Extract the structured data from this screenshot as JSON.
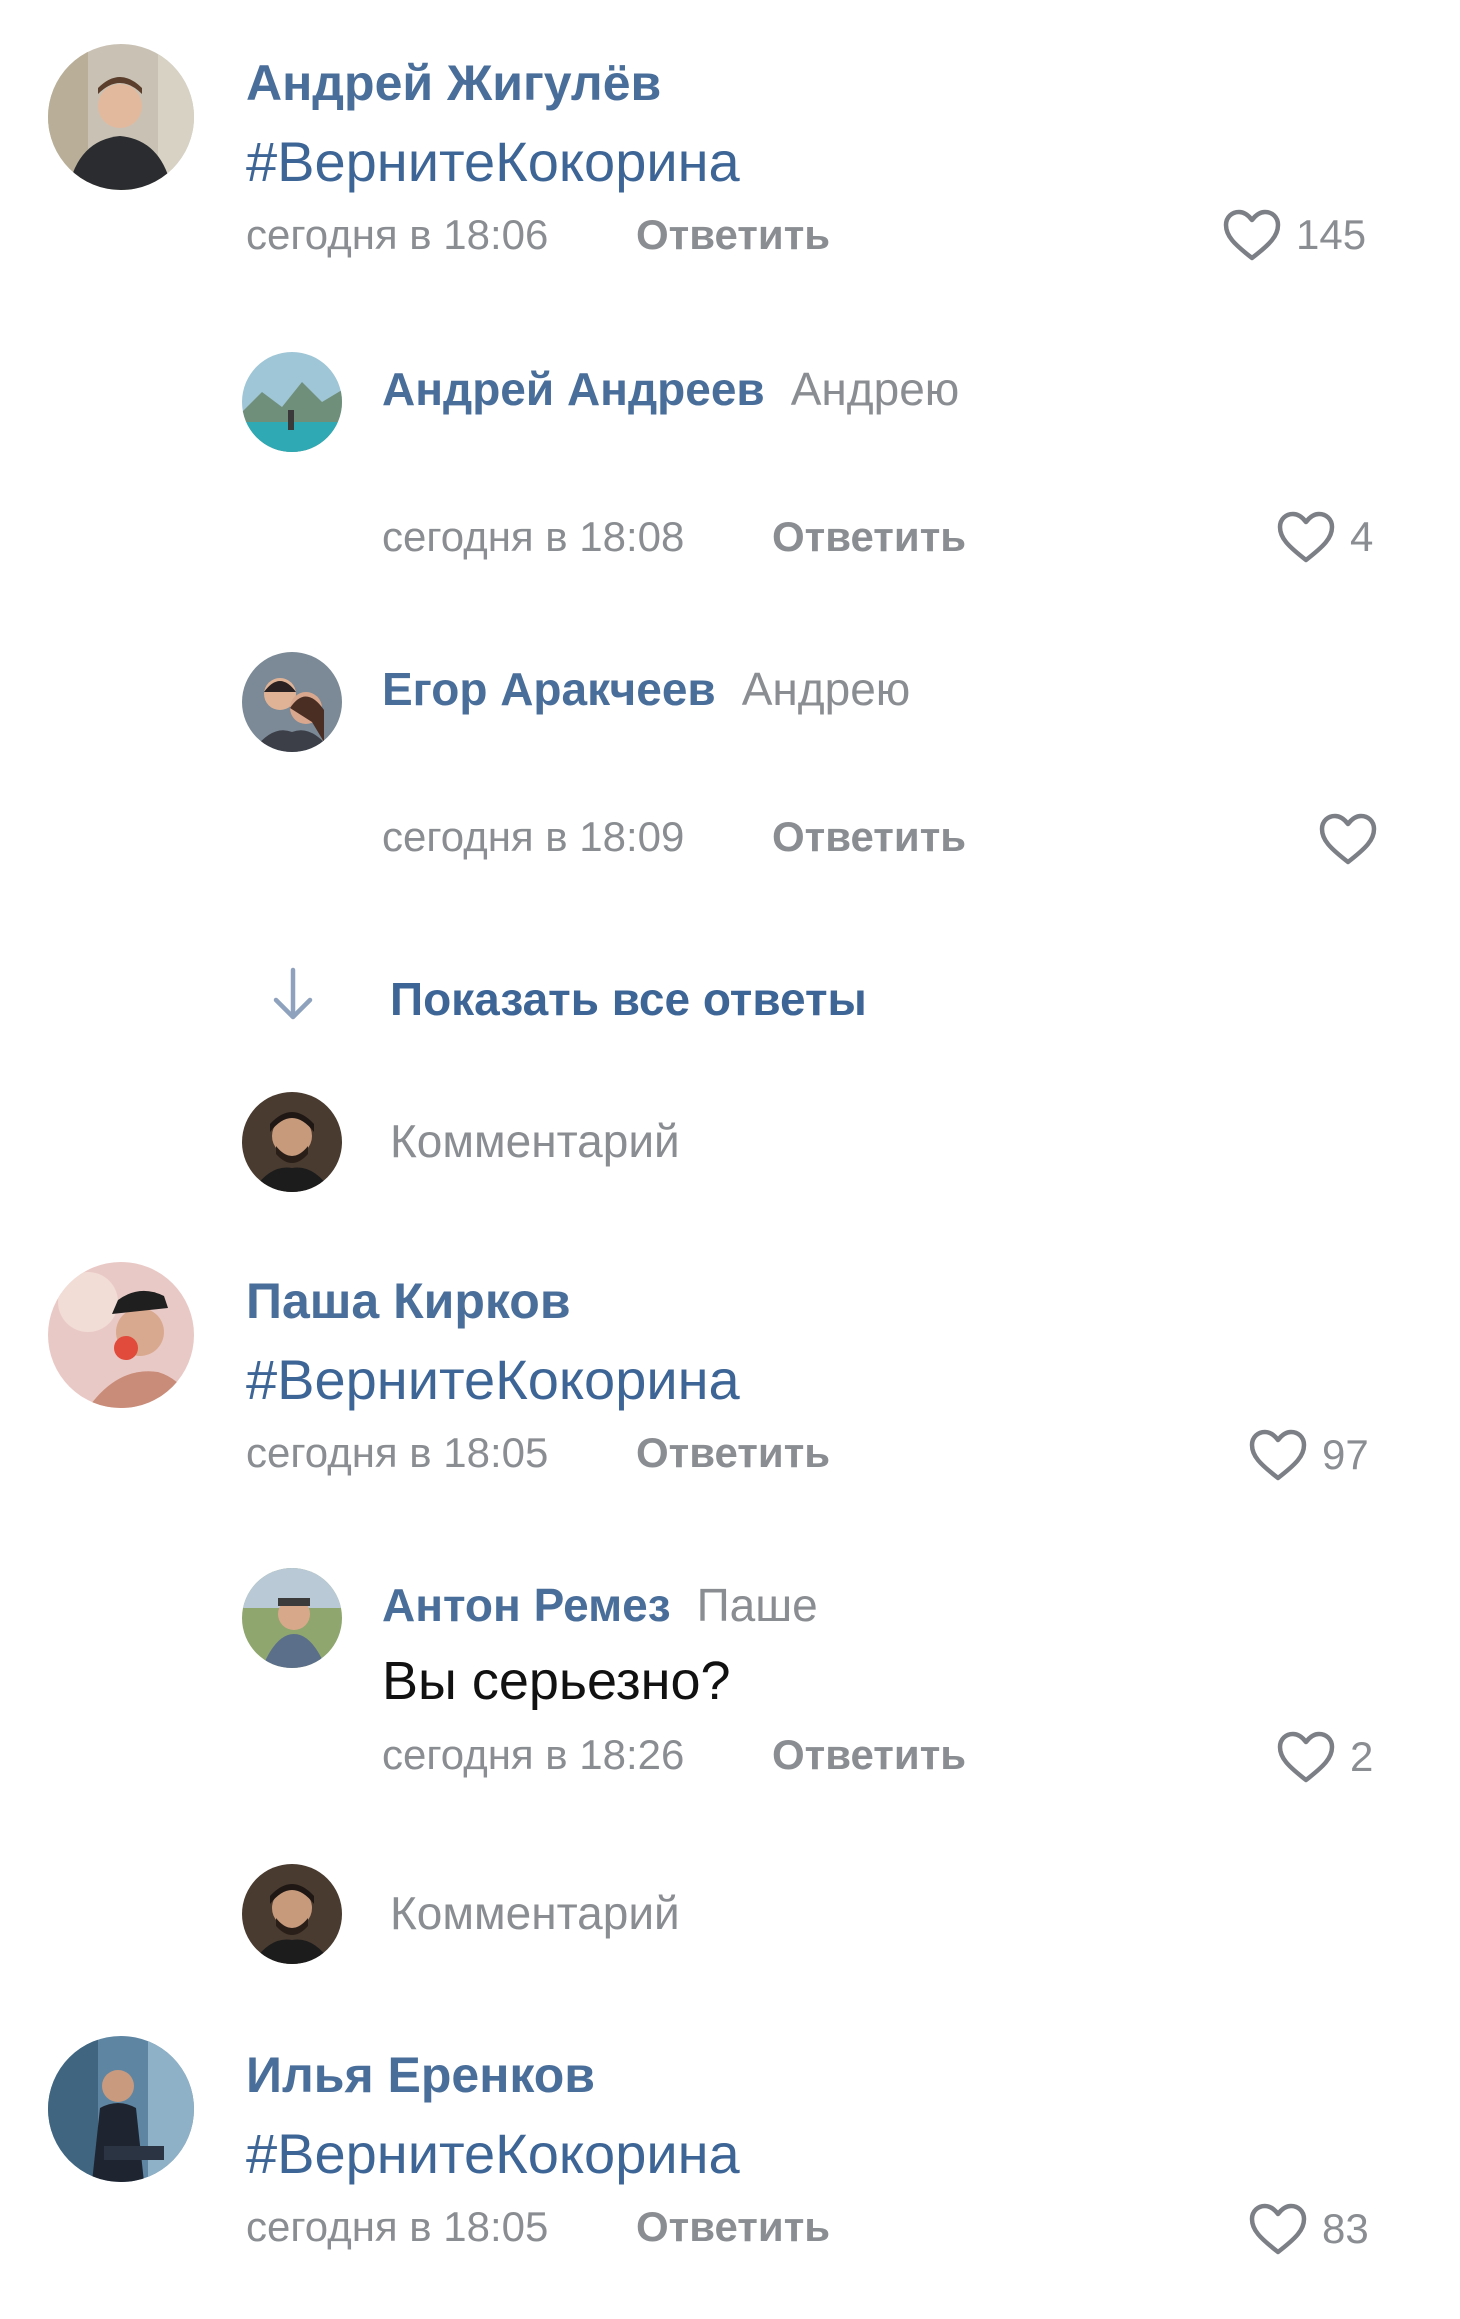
{
  "comments": [
    {
      "author": "Андрей Жигулёв",
      "text": "#ВернитеКокорина",
      "time": "сегодня в 18:06",
      "reply": "Ответить",
      "likes": "145",
      "replies": [
        {
          "author": "Андрей Андреев",
          "to": "Андрею",
          "time": "сегодня в 18:08",
          "reply": "Ответить",
          "likes": "4"
        },
        {
          "author": "Егор Аракчеев",
          "to": "Андрею",
          "time": "сегодня в 18:09",
          "reply": "Ответить",
          "likes": ""
        }
      ],
      "show_all": "Показать все ответы",
      "comment_placeholder": "Комментарий"
    },
    {
      "author": "Паша Кирков",
      "text": "#ВернитеКокорина",
      "time": "сегодня в 18:05",
      "reply": "Ответить",
      "likes": "97",
      "replies": [
        {
          "author": "Антон Ремез",
          "to": "Паше",
          "text": "Вы серьезно?",
          "time": "сегодня в 18:26",
          "reply": "Ответить",
          "likes": "2"
        }
      ],
      "comment_placeholder": "Комментарий"
    },
    {
      "author": "Илья Еренков",
      "text": "#ВернитеКокорина",
      "time": "сегодня в 18:05",
      "reply": "Ответить",
      "likes": "83"
    }
  ],
  "colors": {
    "name": "#4a6e9a",
    "hashtag": "#3d6596",
    "meta": "#8a8d91"
  }
}
